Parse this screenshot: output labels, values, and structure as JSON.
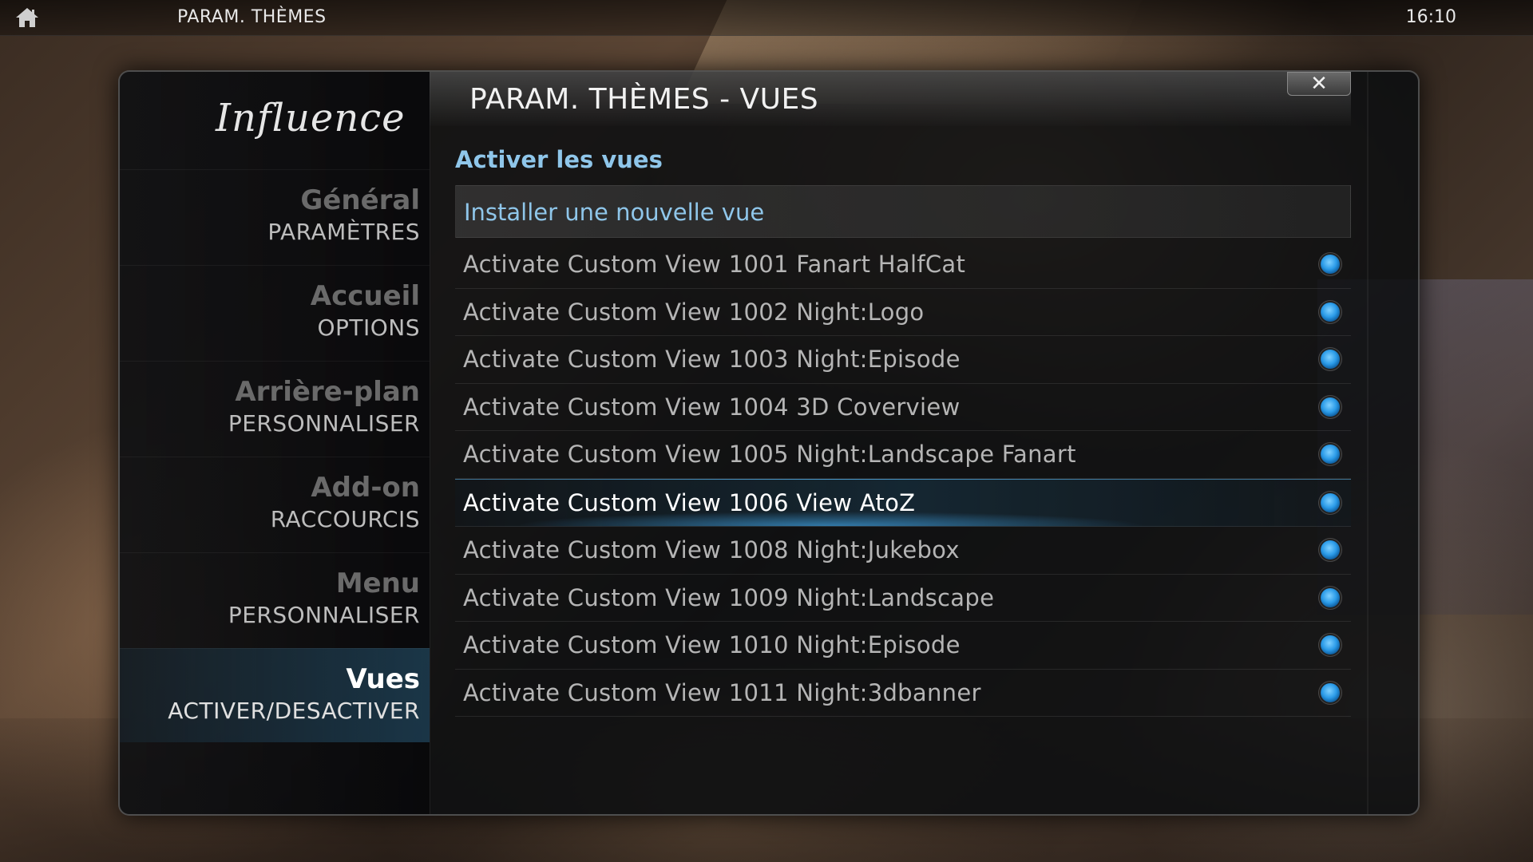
{
  "topbar": {
    "title": "PARAM. THÈMES",
    "clock": "16:10"
  },
  "dialog": {
    "logo": "Influence",
    "title": "PARAM. THÈMES - VUES",
    "close_label": "✕",
    "section_title": "Activer les vues",
    "install_label": "Installer une nouvelle vue"
  },
  "sidebar": {
    "items": [
      {
        "main": "Général",
        "sub": "PARAMÈTRES"
      },
      {
        "main": "Accueil",
        "sub": "OPTIONS"
      },
      {
        "main": "Arrière-plan",
        "sub": "PERSONNALISER"
      },
      {
        "main": "Add-on",
        "sub": "RACCOURCIS"
      },
      {
        "main": "Menu",
        "sub": "PERSONNALISER"
      },
      {
        "main": "Vues",
        "sub": "ACTIVER/DESACTIVER"
      }
    ]
  },
  "views": [
    {
      "label": "Activate Custom View 1001 Fanart HalfCat",
      "enabled": true
    },
    {
      "label": "Activate Custom View 1002 Night:Logo",
      "enabled": true
    },
    {
      "label": "Activate Custom View 1003 Night:Episode",
      "enabled": true
    },
    {
      "label": "Activate Custom View 1004 3D Coverview",
      "enabled": true
    },
    {
      "label": "Activate Custom View 1005 Night:Landscape Fanart",
      "enabled": true
    },
    {
      "label": "Activate Custom View 1006 View AtoZ",
      "enabled": true
    },
    {
      "label": "Activate Custom View 1008 Night:Jukebox",
      "enabled": true
    },
    {
      "label": "Activate Custom View 1009 Night:Landscape",
      "enabled": true
    },
    {
      "label": "Activate Custom View 1010 Night:Episode",
      "enabled": true
    },
    {
      "label": "Activate Custom View 1011 Night:3dbanner",
      "enabled": true
    }
  ],
  "colors": {
    "accent": "#8fc6ea",
    "radio_on": "#2b9be8",
    "selected_glow": "#3c96d2"
  },
  "icons": {
    "home": "home-icon",
    "close": "close-icon"
  }
}
